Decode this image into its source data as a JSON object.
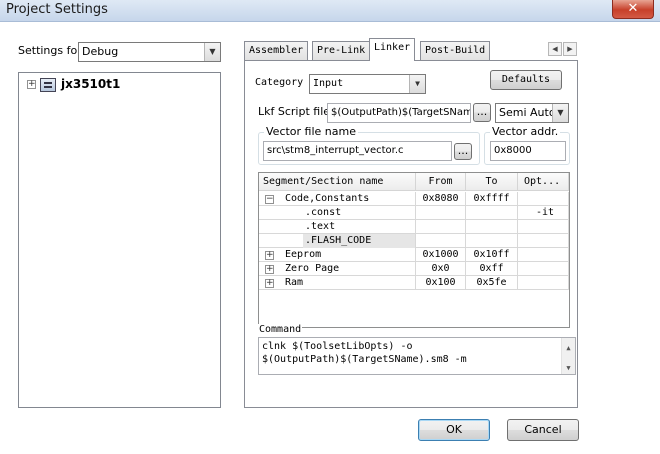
{
  "window": {
    "title": "Project Settings",
    "close_glyph": "✕"
  },
  "settings_for": {
    "label": "Settings for:",
    "value": "Debug"
  },
  "tree": {
    "project": "jx3510t1",
    "expander": "+"
  },
  "tabs": [
    "Assembler",
    "Pre-Link",
    "Linker",
    "Post-Build"
  ],
  "active_tab": "Linker",
  "tab_scroll": {
    "left": "◀",
    "right": "▶"
  },
  "linker": {
    "category_label": "Category",
    "category_value": "Input",
    "defaults_button": "Defaults",
    "lkf_label": "Lkf Script file:",
    "lkf_value": "$(OutputPath)$(TargetSName",
    "browse_label": "...",
    "lkf_mode": "Semi Auto",
    "vector_group_label": "Vector file name",
    "vector_file": "src\\stm8_interrupt_vector.c",
    "vector_addr_label": "Vector addr.",
    "vector_addr": "0x8000",
    "grid": {
      "headers": [
        "Segment/Section name",
        "From",
        "To",
        "Opt..."
      ],
      "rows": [
        {
          "expander": "−",
          "name": "Code,Constants",
          "from": "0x8080",
          "to": "0xffff",
          "opt": ""
        },
        {
          "expander": "",
          "name": ".const",
          "from": "",
          "to": "",
          "opt": "-it"
        },
        {
          "expander": "",
          "name": ".text",
          "from": "",
          "to": "",
          "opt": ""
        },
        {
          "expander": "",
          "name": ".FLASH_CODE",
          "from": "",
          "to": "",
          "opt": ""
        },
        {
          "expander": "+",
          "name": "Eeprom",
          "from": "0x1000",
          "to": "0x10ff",
          "opt": ""
        },
        {
          "expander": "+",
          "name": "Zero Page",
          "from": "0x0",
          "to": "0xff",
          "opt": ""
        },
        {
          "expander": "+",
          "name": "Ram",
          "from": "0x100",
          "to": "0x5fe",
          "opt": ""
        }
      ]
    },
    "command_label": "Command",
    "command_line1": "clnk $(ToolsetLibOpts) -o",
    "command_line2": "$(OutputPath)$(TargetSName).sm8 -m"
  },
  "buttons": {
    "ok": "OK",
    "cancel": "Cancel"
  },
  "colors": {
    "selected_row": "#e6e6e6",
    "title_bar": "#c6d6eb",
    "close_button": "#c7402a"
  }
}
